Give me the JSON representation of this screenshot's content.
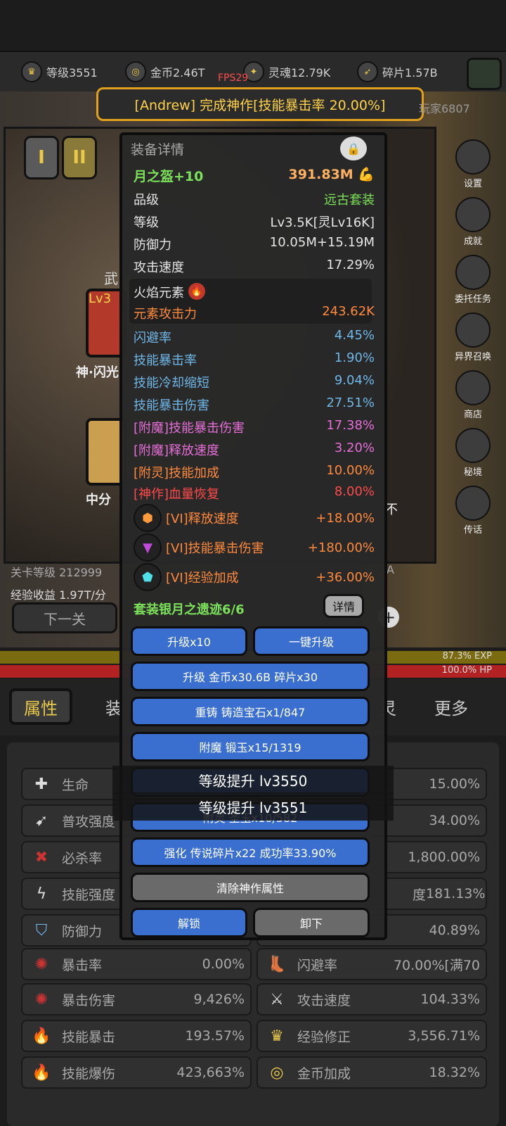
{
  "resources": [
    {
      "icon": "crown-icon",
      "label": "等级3551"
    },
    {
      "icon": "coin-icon",
      "label": "金币2.46T"
    },
    {
      "icon": "soul-icon",
      "label": "灵魂12.79K"
    },
    {
      "icon": "fragment-icon",
      "label": "碎片1.57B"
    }
  ],
  "fps": "FPS29",
  "banner": "[Andrew] 完成神作[技能暴击率 20.00%]",
  "banner_side_right": "玩家6807",
  "roman_buttons": [
    "I",
    "II"
  ],
  "background_text": {
    "weapon": "武",
    "lv": "Lv3",
    "skill_name": "神·闪光",
    "mid": "中分",
    "stage": "关卡等级 212999",
    "exp_income": "经验收益 1.97T/分",
    "next_stage": "下一关",
    "right_letter": "不",
    "right_a": "A"
  },
  "right_menu": [
    "设置",
    "成就",
    "委托任务",
    "异界召唤",
    "商店",
    "秘境",
    "传话"
  ],
  "bars": {
    "exp": "87.3% EXP",
    "hp": "100.0% HP"
  },
  "tabs": [
    "属性",
    "装",
    "灵",
    "更多"
  ],
  "panel": {
    "title": "装备详情",
    "item_name": "月之盔+10",
    "power": "391.83M",
    "rows": [
      {
        "k": "品级",
        "v": "远古套装"
      },
      {
        "k": "等级",
        "v": "Lv3.5K[灵Lv16K]"
      },
      {
        "k": "防御力",
        "v": "10.05M+15.19M"
      },
      {
        "k": "攻击速度",
        "v": "17.29%"
      }
    ],
    "element_title": "火焰元素",
    "element_attack": {
      "k": "元素攻击力",
      "v": "243.62K"
    },
    "affixes": [
      {
        "k": "闪避率",
        "v": "4.45%",
        "c": "blue"
      },
      {
        "k": "技能暴击率",
        "v": "1.90%",
        "c": "blue"
      },
      {
        "k": "技能冷却缩短",
        "v": "9.04%",
        "c": "blue"
      },
      {
        "k": "技能暴击伤害",
        "v": "27.51%",
        "c": "blue"
      },
      {
        "k": "[附魔]技能暴击伤害",
        "v": "17.38%",
        "c": "pink"
      },
      {
        "k": "[附魔]释放速度",
        "v": "3.20%",
        "c": "pink"
      },
      {
        "k": "[附灵]技能加成",
        "v": "10.00%",
        "c": "orange"
      },
      {
        "k": "[神作]血量恢复",
        "v": "8.00%",
        "c": "red"
      }
    ],
    "gems": [
      {
        "k": "[VI]释放速度",
        "v": "+18.00%"
      },
      {
        "k": "[VI]技能暴击伤害",
        "v": "+180.00%"
      },
      {
        "k": "[VI]经验加成",
        "v": "+36.00%"
      }
    ],
    "set_label": "套装银月之遗迹6/6",
    "detail_button": "详情",
    "buttons": {
      "upgrade10": "升级x10",
      "upgrade_all": "一键升级",
      "upgrade": "升级 金币x30.6B 碎片x30",
      "reforge": "重铸 铸造宝石x1/847",
      "enchant": "附魔 锻玉x15/1319",
      "spirit": "附灵 圣玉x10/582",
      "strengthen": "强化 传说碎片x22 成功率33.90%",
      "clear": "清除神作属性",
      "unlock": "解锁",
      "unequip": "卸下"
    }
  },
  "toasts": [
    "等级提升 lv3550",
    "等级提升 lv3551"
  ],
  "stats_left": [
    {
      "icon": "sword-plus-icon",
      "name": "生命",
      "val": ""
    },
    {
      "icon": "spear-icon",
      "name": "普攻强度",
      "val": ""
    },
    {
      "icon": "crit-kill-icon",
      "name": "必杀率",
      "val": ""
    },
    {
      "icon": "lightning-icon",
      "name": "技能强度",
      "val": ""
    },
    {
      "icon": "shield-icon",
      "name": "防御力",
      "val": ""
    },
    {
      "icon": "crit-rate-icon",
      "name": "暴击率",
      "val": "0.00%"
    },
    {
      "icon": "crit-damage-icon",
      "name": "暴击伤害",
      "val": "9,426%"
    },
    {
      "icon": "blue-flame-icon",
      "name": "技能暴击",
      "val": "193.57%"
    },
    {
      "icon": "blue-flame-icon",
      "name": "技能爆伤",
      "val": "423,663%"
    }
  ],
  "stats_right": [
    {
      "icon": "",
      "name": "",
      "val": "15.00%"
    },
    {
      "icon": "",
      "name": "",
      "val": "34.00%"
    },
    {
      "icon": "",
      "name": "",
      "val": "1,800.00%"
    },
    {
      "icon": "",
      "name": "度",
      "val": "181.13%"
    },
    {
      "icon": "",
      "name": "",
      "val": "40.89%"
    },
    {
      "icon": "boot-icon",
      "name": "闪避率",
      "val": "70.00%[满70"
    },
    {
      "icon": "swords-icon",
      "name": "攻击速度",
      "val": "104.33%"
    },
    {
      "icon": "crown-icon",
      "name": "经验修正",
      "val": "3,556.71%"
    },
    {
      "icon": "coin-icon",
      "name": "金币加成",
      "val": "18.32%"
    }
  ]
}
